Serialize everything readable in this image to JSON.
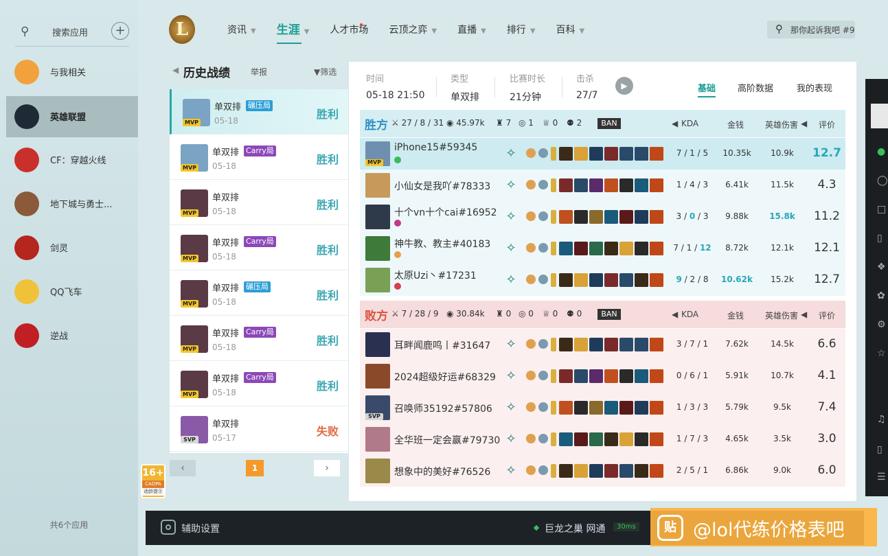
{
  "sidebar": {
    "search_label": "搜索应用",
    "items": [
      {
        "label": "与我相关",
        "color": "#f2a23c"
      },
      {
        "label": "英雄联盟",
        "color": "#1e2a36"
      },
      {
        "label": "CF：穿越火线",
        "color": "#c9302c"
      },
      {
        "label": "地下城与勇士...",
        "color": "#8a5a3a"
      },
      {
        "label": "剑灵",
        "color": "#b5261e"
      },
      {
        "label": "QQ飞车",
        "color": "#f0c23a"
      },
      {
        "label": "逆战",
        "color": "#c01f26"
      }
    ],
    "count": "共6个应用"
  },
  "topnav": {
    "items": [
      {
        "label": "资讯",
        "caret": true
      },
      {
        "label": "生涯",
        "caret": true,
        "active": true
      },
      {
        "label": "人才市场",
        "dot": true
      },
      {
        "label": "云顶之弈",
        "caret": true
      },
      {
        "label": "直播",
        "caret": true
      },
      {
        "label": "排行",
        "caret": true
      },
      {
        "label": "百科",
        "caret": true
      }
    ],
    "search_value": "那你起诉我吧 #9"
  },
  "history": {
    "title": "历史战绩",
    "report": "举报",
    "filter": "筛选",
    "items": [
      {
        "mode": "单双排",
        "tag": "碾压局",
        "tag_color": "#2b9ed6",
        "badge": "MVP",
        "date": "05-18",
        "result": "胜利",
        "win": true,
        "color": "#7aa3c4"
      },
      {
        "mode": "单双排",
        "tag": "Carry局",
        "tag_color": "#8d48b8",
        "badge": "MVP",
        "date": "05-18",
        "result": "胜利",
        "win": true,
        "color": "#7aa3c4"
      },
      {
        "mode": "单双排",
        "tag": "",
        "tag_color": "",
        "badge": "MVP",
        "date": "05-18",
        "result": "胜利",
        "win": true,
        "color": "#5a3a44"
      },
      {
        "mode": "单双排",
        "tag": "Carry局",
        "tag_color": "#8d48b8",
        "badge": "MVP",
        "date": "05-18",
        "result": "胜利",
        "win": true,
        "color": "#5a3a44"
      },
      {
        "mode": "单双排",
        "tag": "碾压局",
        "tag_color": "#2b9ed6",
        "badge": "MVP",
        "date": "05-18",
        "result": "胜利",
        "win": true,
        "color": "#5a3a44"
      },
      {
        "mode": "单双排",
        "tag": "Carry局",
        "tag_color": "#8d48b8",
        "badge": "MVP",
        "date": "05-18",
        "result": "胜利",
        "win": true,
        "color": "#5a3a44"
      },
      {
        "mode": "单双排",
        "tag": "Carry局",
        "tag_color": "#8d48b8",
        "badge": "MVP",
        "date": "05-18",
        "result": "胜利",
        "win": true,
        "color": "#5a3a44"
      },
      {
        "mode": "单双排",
        "tag": "",
        "tag_color": "",
        "badge": "SVP",
        "date": "05-17",
        "result": "失败",
        "win": false,
        "color": "#8a5aa8"
      }
    ],
    "page": "1"
  },
  "age_badge": {
    "rating": "16+",
    "sub": "CADPA",
    "note": "适龄提示"
  },
  "match": {
    "time_label": "时间",
    "time": "05-18 21:50",
    "type_label": "类型",
    "type": "单双排",
    "duration_label": "比赛时长",
    "duration": "21分钟",
    "kills_label": "击杀",
    "kills": "27/7",
    "tabs": [
      "基础",
      "高阶数据",
      "我的表现"
    ]
  },
  "columns": {
    "kda": "KDA",
    "gold": "金钱",
    "damage": "英雄伤害",
    "score": "评价",
    "ban": "BAN"
  },
  "win_team": {
    "name": "胜方",
    "kda": "27 / 8 / 31",
    "gold": "45.97k",
    "towers": "7",
    "inhib": "1",
    "baron": "0",
    "dragon": "2",
    "players": [
      {
        "name": "iPhone15#59345",
        "badge": "MVP",
        "k": "7",
        "d": "1",
        "a": "5",
        "gold": "10.35k",
        "dmg": "10.9k",
        "score": "12.7",
        "best_score": true,
        "hl": true,
        "color": "#6f8fb0",
        "mini": "#3bbb5a"
      },
      {
        "name": "小仙女是我吖#78333",
        "badge": "",
        "k": "1",
        "d": "4",
        "a": "3",
        "gold": "6.41k",
        "dmg": "11.5k",
        "score": "4.3",
        "color": "#c79a5c",
        "mini": ""
      },
      {
        "name": "十个vn十个cai#16952",
        "badge": "",
        "k": "3",
        "d": "0",
        "a": "3",
        "d_hi": true,
        "gold": "9.88k",
        "dmg": "15.8k",
        "dmg_hi": true,
        "score": "11.2",
        "color": "#2e3a4a",
        "mini": "#c03a8a"
      },
      {
        "name": "神牛教、教主#40183",
        "badge": "",
        "k": "7",
        "d": "1",
        "a": "12",
        "a_hi": true,
        "gold": "8.72k",
        "dmg": "12.1k",
        "score": "12.1",
        "color": "#3e7a3a",
        "mini": "#e6a04a"
      },
      {
        "name": "太原Uzi丶#17231",
        "badge": "",
        "k": "9",
        "d": "2",
        "a": "8",
        "k_hi": true,
        "gold": "10.62k",
        "gold_hi": true,
        "dmg": "15.2k",
        "score": "12.7",
        "color": "#7aa056",
        "mini": "#d8404a"
      }
    ]
  },
  "lose_team": {
    "name": "败方",
    "kda": "7 / 28 / 9",
    "gold": "30.84k",
    "towers": "0",
    "inhib": "0",
    "baron": "0",
    "dragon": "0",
    "players": [
      {
        "name": "耳畔闻鹿鸣丨#31647",
        "badge": "",
        "k": "3",
        "d": "7",
        "a": "1",
        "gold": "7.62k",
        "dmg": "14.5k",
        "score": "6.6",
        "color": "#2a3050"
      },
      {
        "name": "2024超级好运#68329",
        "badge": "",
        "k": "0",
        "d": "6",
        "a": "1",
        "gold": "5.91k",
        "dmg": "10.7k",
        "score": "4.1",
        "color": "#8a4a2a"
      },
      {
        "name": "召唤师35192#57806",
        "badge": "SVP",
        "k": "1",
        "d": "3",
        "a": "3",
        "gold": "5.79k",
        "dmg": "9.5k",
        "score": "7.4",
        "color": "#3a4a6a"
      },
      {
        "name": "全华班一定会赢#79730",
        "badge": "",
        "k": "1",
        "d": "7",
        "a": "3",
        "gold": "4.65k",
        "dmg": "3.5k",
        "score": "3.0",
        "color": "#b07a8a"
      },
      {
        "name": "想象中的美好#76526",
        "badge": "",
        "k": "2",
        "d": "5",
        "a": "1",
        "gold": "6.86k",
        "dmg": "9.0k",
        "score": "6.0",
        "color": "#9a8a4a"
      }
    ]
  },
  "bottombar": {
    "assist": "辅助设置",
    "server": "巨龙之巢 网通",
    "ping": "30ms"
  },
  "watermark": {
    "icon": "贴",
    "text": "@lol代练价格表吧"
  },
  "colors": {
    "accent": "#1b9e96",
    "win_blue": "#2d92c8",
    "lose_red": "#d8543f",
    "highlight": "#2aa6b8"
  }
}
